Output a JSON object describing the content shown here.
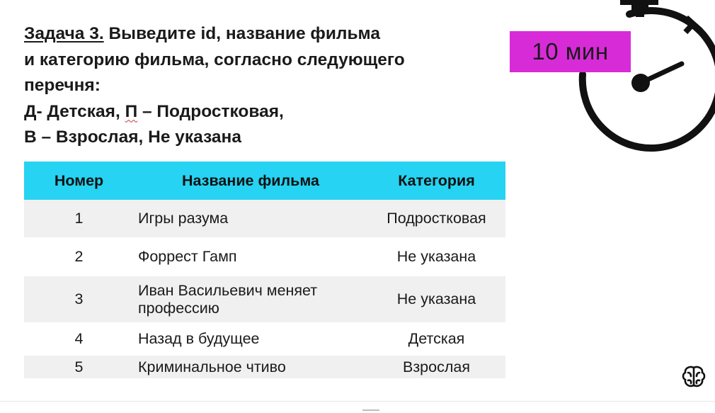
{
  "task": {
    "label": "Задача 3.",
    "line1_rest": " Выведите id, название фильма",
    "line2": "и категорию фильма, согласно следующего",
    "line3": "перечня:",
    "line4_a": "Д- Детская, ",
    "line4_b": "П",
    "line4_c": " – Подростковая,",
    "line5": "В – Взрослая, Не указана"
  },
  "timer": {
    "label": "10 мин",
    "icon": "stopwatch-icon",
    "badge_color": "#d82bd8"
  },
  "table": {
    "header_color": "#26d3f2",
    "columns": [
      "Номер",
      "Название фильма",
      "Категория"
    ],
    "rows": [
      {
        "num": "1",
        "title": "Игры разума",
        "category": "Подростковая"
      },
      {
        "num": "2",
        "title": "Форрест Гамп",
        "category": "Не указана"
      },
      {
        "num": "3",
        "title": "Иван Васильевич меняет профессию",
        "category": "Не указана"
      },
      {
        "num": "4",
        "title": "Назад в будущее",
        "category": "Детская"
      },
      {
        "num": "5",
        "title": "Криминальное чтиво",
        "category": "Взрослая"
      }
    ]
  },
  "logo": {
    "icon": "brain-logo-icon"
  }
}
